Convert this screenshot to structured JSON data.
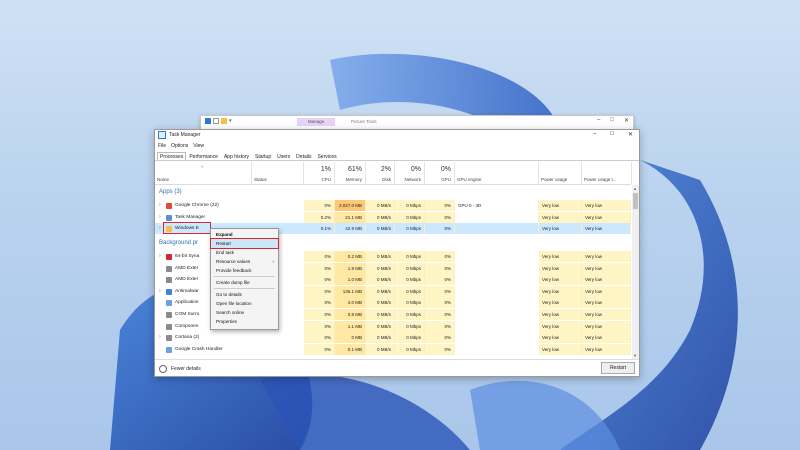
{
  "explorer": {
    "manage_tab": "Manage",
    "tools_tab": "Picture Tools"
  },
  "window": {
    "title": "Task Manager"
  },
  "menu": [
    "File",
    "Options",
    "View"
  ],
  "tabs": [
    "Processes",
    "Performance",
    "App history",
    "Startup",
    "Users",
    "Details",
    "Services"
  ],
  "columns": {
    "name": "Name",
    "status": "Status",
    "cpu": {
      "pct": "1%",
      "label": "CPU"
    },
    "memory": {
      "pct": "61%",
      "label": "Memory"
    },
    "disk": {
      "pct": "2%",
      "label": "Disk"
    },
    "network": {
      "pct": "0%",
      "label": "Network"
    },
    "gpu": {
      "pct": "0%",
      "label": "GPU"
    },
    "gpu_engine": "GPU engine",
    "power": "Power usage",
    "power_trend": "Power usage t..."
  },
  "groups": {
    "apps": "Apps (3)",
    "background": "Background pr"
  },
  "apps": [
    {
      "name": "Google Chrome (22)",
      "cpu": "0%",
      "memory": "2,027.0 MB",
      "disk": "0 MB/s",
      "network": "0 Mbps",
      "gpu": "0%",
      "gpu_engine": "GPU 0 - 3D",
      "power": "Very low",
      "power_trend": "Very low"
    },
    {
      "name": "Task Manager",
      "cpu": "0.2%",
      "memory": "21.1 MB",
      "disk": "0 MB/s",
      "network": "0 Mbps",
      "gpu": "0%",
      "gpu_engine": "",
      "power": "Very low",
      "power_trend": "Very low"
    },
    {
      "name": "Windows E",
      "cpu": "0.1%",
      "memory": "42.9 MB",
      "disk": "0 MB/s",
      "network": "0 Mbps",
      "gpu": "0%",
      "gpu_engine": "",
      "power": "Very low",
      "power_trend": "Very low"
    }
  ],
  "background": [
    {
      "name": "64-bit Syna",
      "cpu": "0%",
      "memory": "0.2 MB",
      "disk": "0 MB/s",
      "network": "0 Mbps",
      "gpu": "0%",
      "power": "Very low",
      "power_trend": "Very low"
    },
    {
      "name": "AMD Exter",
      "cpu": "0%",
      "memory": "1.9 MB",
      "disk": "0 MB/s",
      "network": "0 Mbps",
      "gpu": "0%",
      "power": "Very low",
      "power_trend": "Very low"
    },
    {
      "name": "AMD Exter",
      "cpu": "0%",
      "memory": "1.0 MB",
      "disk": "0 MB/s",
      "network": "0 Mbps",
      "gpu": "0%",
      "power": "Very low",
      "power_trend": "Very low"
    },
    {
      "name": "Antimalwar",
      "cpu": "0%",
      "memory": "136.1 MB",
      "disk": "0 MB/s",
      "network": "0 Mbps",
      "gpu": "0%",
      "power": "Very low",
      "power_trend": "Very low"
    },
    {
      "name": "Application",
      "cpu": "0%",
      "memory": "4.0 MB",
      "disk": "0 MB/s",
      "network": "0 Mbps",
      "gpu": "0%",
      "power": "Very low",
      "power_trend": "Very low"
    },
    {
      "name": "COM Surro",
      "cpu": "0%",
      "memory": "0.8 MB",
      "disk": "0 MB/s",
      "network": "0 Mbps",
      "gpu": "0%",
      "power": "Very low",
      "power_trend": "Very low"
    },
    {
      "name": "Componen",
      "cpu": "0%",
      "memory": "1.1 MB",
      "disk": "0 MB/s",
      "network": "0 Mbps",
      "gpu": "0%",
      "power": "Very low",
      "power_trend": "Very low"
    },
    {
      "name": "Cortana (2)",
      "cpu": "0%",
      "memory": "0 MB",
      "disk": "0 MB/s",
      "network": "0 Mbps",
      "gpu": "0%",
      "power": "Very low",
      "power_trend": "Very low"
    },
    {
      "name": "Google Crash Handler",
      "cpu": "0%",
      "memory": "0.1 MB",
      "disk": "0 MB/s",
      "network": "0 Mbps",
      "gpu": "0%",
      "power": "Very low",
      "power_trend": "Very low"
    }
  ],
  "context_menu": [
    "Expand",
    "Restart",
    "End task",
    "Resource values",
    "Provide feedback",
    "Create dump file",
    "Go to details",
    "Open file location",
    "Search online",
    "Properties"
  ],
  "footer": {
    "fewer_details": "Fewer details",
    "restart_button": "Restart"
  }
}
